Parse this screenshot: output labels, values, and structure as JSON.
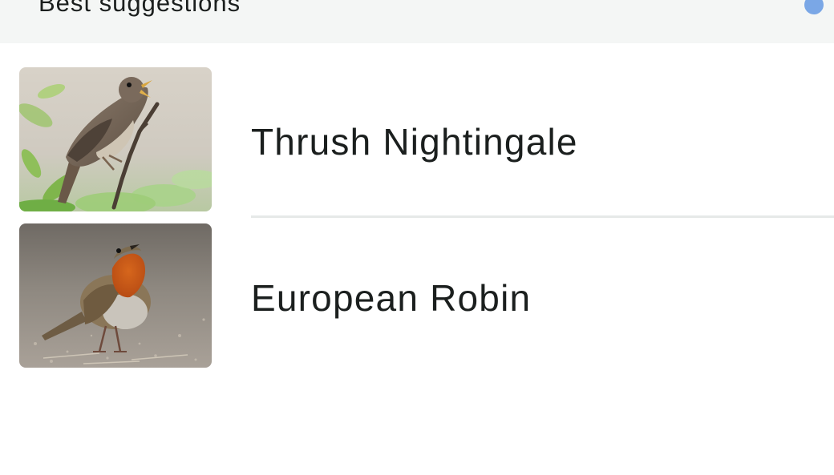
{
  "header": {
    "title": "Best suggestions",
    "indicator_icon": "status-dot-icon",
    "indicator_color": "#7aa7e6"
  },
  "suggestions": [
    {
      "label": "Thrush Nightingale",
      "image": "thrush-nightingale-photo"
    },
    {
      "label": "European Robin",
      "image": "european-robin-photo"
    }
  ]
}
